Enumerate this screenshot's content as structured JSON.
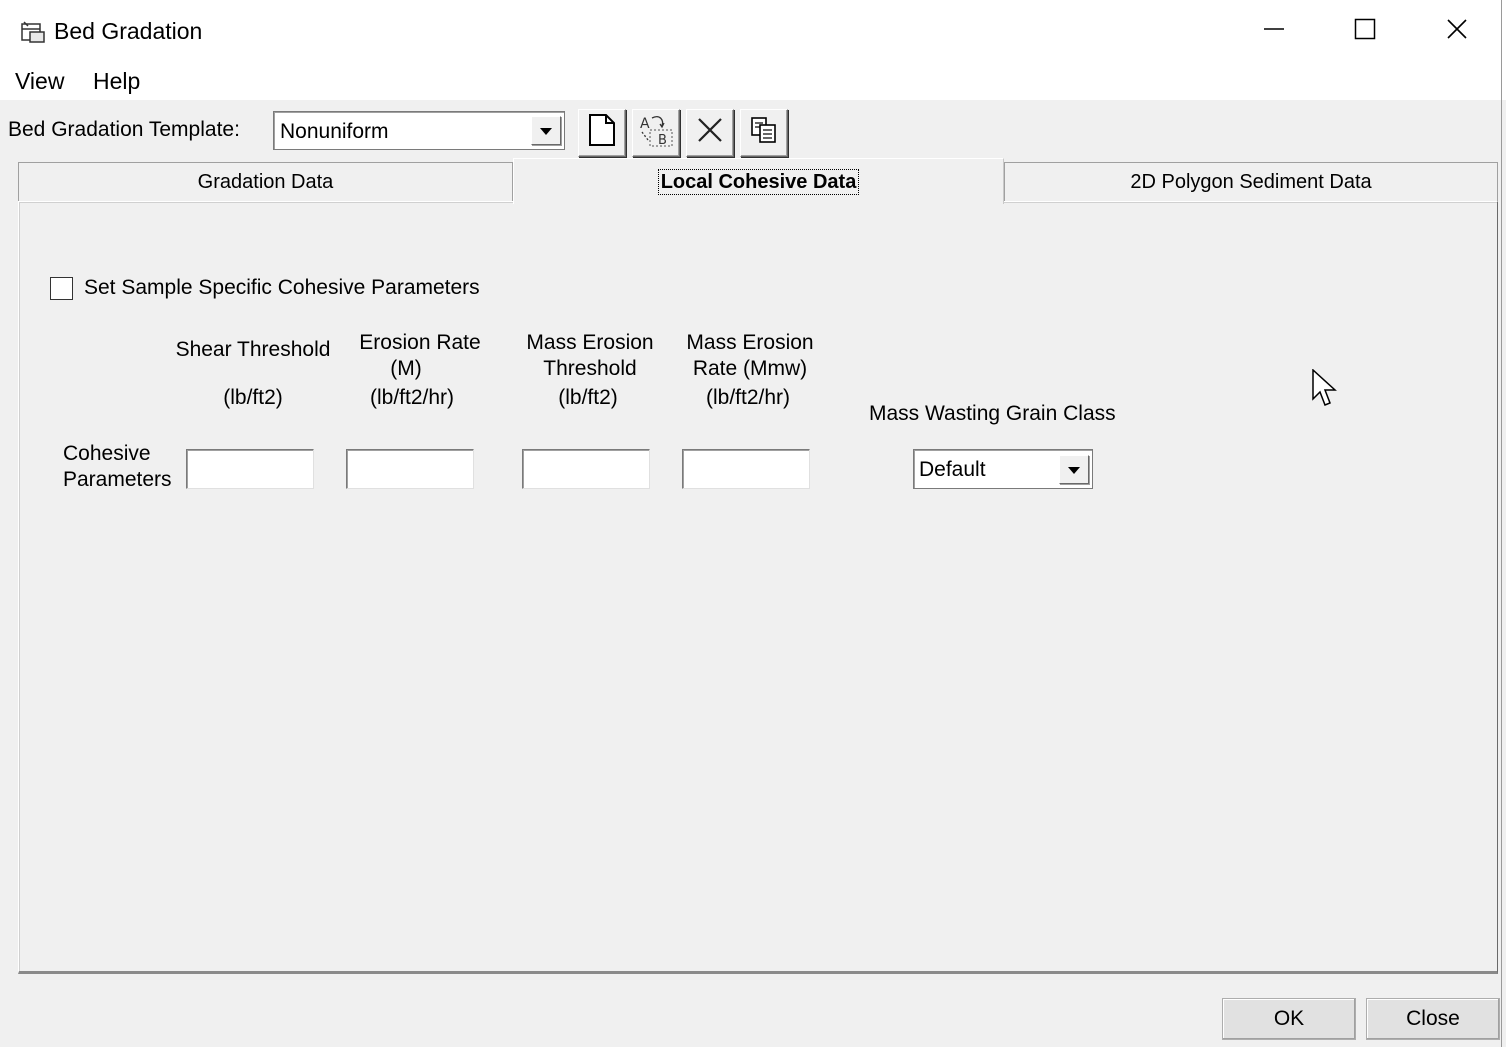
{
  "window": {
    "title": "Bed Gradation",
    "icons": {
      "app": "window-grid-icon",
      "minimize": "minimize-icon",
      "maximize": "maximize-icon",
      "close": "close-icon"
    }
  },
  "menu": {
    "items": [
      {
        "label": "View"
      },
      {
        "label": "Help"
      }
    ]
  },
  "template": {
    "label": "Bed Gradation Template:",
    "selected": "Nonuniform",
    "toolbar_icons": [
      "new-document-icon",
      "rename-ab-icon",
      "delete-x-icon",
      "copy-icon"
    ]
  },
  "tabs": [
    {
      "label": "Gradation Data",
      "active": false
    },
    {
      "label": "Local Cohesive Data",
      "active": true
    },
    {
      "label": "2D Polygon Sediment Data",
      "active": false
    }
  ],
  "cohesive": {
    "checkbox_label": "Set Sample Specific Cohesive Parameters",
    "checkbox_checked": false,
    "columns": {
      "shear_threshold": {
        "line1": "Shear Threshold",
        "unit": "(lb/ft2)",
        "value": ""
      },
      "erosion_rate": {
        "line1": "Erosion Rate",
        "line2": "(M)",
        "unit": "(lb/ft2/hr)",
        "value": ""
      },
      "mass_erosion_threshold": {
        "line1": "Mass Erosion",
        "line2": "Threshold",
        "unit": "(lb/ft2)",
        "value": ""
      },
      "mass_erosion_rate": {
        "line1": "Mass Erosion",
        "line2": "Rate (Mmw)",
        "unit": "(lb/ft2/hr)",
        "value": ""
      }
    },
    "mass_wasting_label": "Mass Wasting Grain Class",
    "mass_wasting_selected": "Default",
    "row_label_line1": "Cohesive",
    "row_label_line2": "Parameters"
  },
  "buttons": {
    "ok": "OK",
    "close": "Close"
  }
}
